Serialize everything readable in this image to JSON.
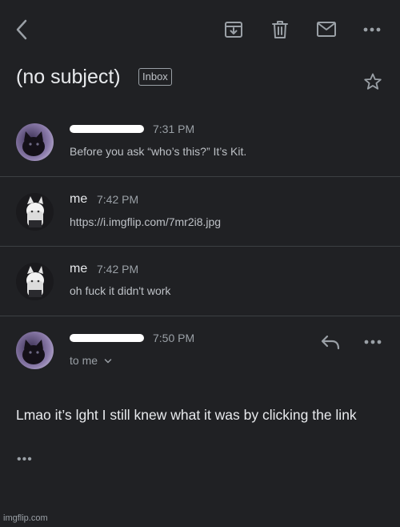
{
  "toolbar": {
    "back_icon": "chevron-left-icon",
    "archive_icon": "archive-icon",
    "delete_icon": "trash-icon",
    "mark_unread_icon": "envelope-icon",
    "more_icon": "more-horizontal-icon"
  },
  "thread": {
    "subject": "(no subject)",
    "label": "Inbox",
    "star_icon": "star-outline-icon"
  },
  "messages": [
    {
      "time": "7:31 PM",
      "snippet": "Before you ask “who’s this?” It’s Kit."
    },
    {
      "sender": "me",
      "time": "7:42 PM",
      "snippet": "https://i.imgflip.com/7mr2i8.jpg"
    },
    {
      "sender": "me",
      "time": "7:42 PM",
      "snippet": "oh fuck it didn't work"
    },
    {
      "time": "7:50 PM",
      "recipients": "to me",
      "body": "Lmao it’s lght I still knew what it was by clicking the link"
    }
  ],
  "expanded": {
    "show_trimmed": "•••"
  },
  "watermark": "imgflip.com",
  "colors": {
    "background": "#202124",
    "text": "#e8eaed",
    "muted": "#9aa0a6",
    "divider": "#3c4043"
  }
}
